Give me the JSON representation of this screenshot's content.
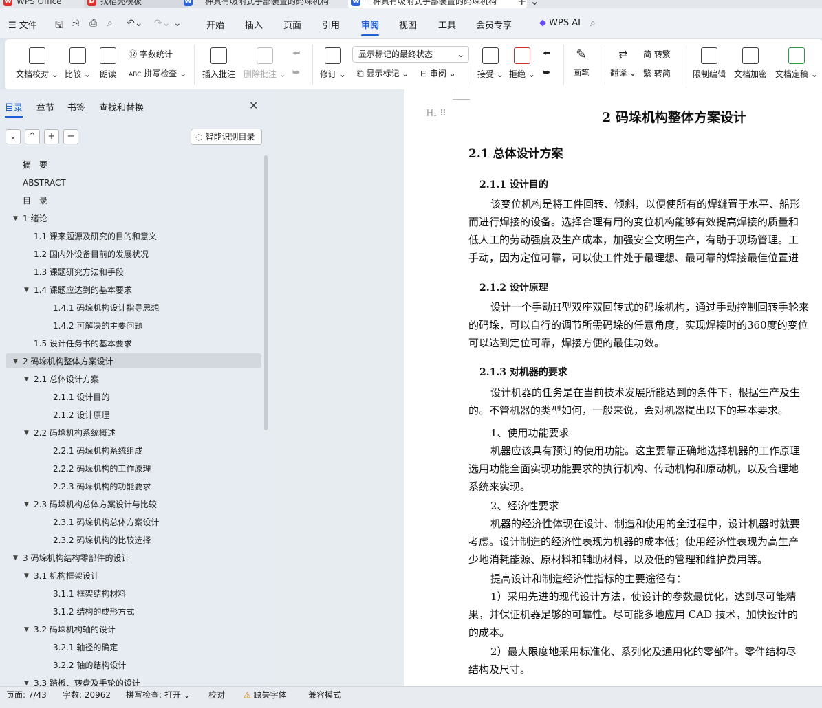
{
  "tabs": [
    {
      "label": "WPS Office",
      "icon": "wps-logo"
    },
    {
      "label": "找稻壳模板",
      "icon": "docer-logo"
    },
    {
      "label": "一种具有吸附式手部装置的码垛机构",
      "icon": "writer-icon"
    },
    {
      "label": "一种具有吸附式手部装置的码垛机构",
      "icon": "writer-icon"
    }
  ],
  "menubar": {
    "file": "文件",
    "items": [
      "开始",
      "插入",
      "页面",
      "引用",
      "审阅",
      "视图",
      "工具",
      "会员专享"
    ],
    "active": "审阅",
    "wps_ai": "WPS AI"
  },
  "ribbon": {
    "doc_check": "文档校对",
    "compare": "比较",
    "read_aloud": "朗读",
    "word_count": "字数统计",
    "spell_check": "拼写检查",
    "insert_comment": "插入批注",
    "delete_comment": "删除批注",
    "track": "修订",
    "markup_mode": "显示标记的最终状态",
    "show_markup": "显示标记",
    "review": "审阅",
    "accept": "接受",
    "reject": "拒绝",
    "pen": "画笔",
    "translate": "翻译",
    "to_trad": "转繁",
    "to_simp": "转简",
    "restrict_edit": "限制编辑",
    "encrypt": "文档加密",
    "finalize": "文档定稿"
  },
  "nav": {
    "tabs": [
      "目录",
      "章节",
      "书签",
      "查找和替换"
    ],
    "smart_toc": "智能识别目录",
    "toc": [
      {
        "text": "摘　要",
        "level": 0
      },
      {
        "text": "ABSTRACT",
        "level": 0
      },
      {
        "text": "目　录",
        "level": 0
      },
      {
        "text": "1  绪论",
        "level": 0,
        "expand": true
      },
      {
        "text": "1.1  课来题源及研究的目的和意义",
        "level": 1
      },
      {
        "text": "1.2  国内外设备目前的发展状况",
        "level": 1
      },
      {
        "text": "1.3  课题研究方法和手段",
        "level": 1
      },
      {
        "text": "1.4  课题应达到的基本要求",
        "level": 1,
        "expand": true
      },
      {
        "text": "1.4.1  码垛机构设计指导思想",
        "level": 2
      },
      {
        "text": "1.4.2  可解决的主要问题",
        "level": 2
      },
      {
        "text": "1.5  设计任务书的基本要求",
        "level": 1
      },
      {
        "text": "2  码垛机构整体方案设计",
        "level": 0,
        "expand": true
      },
      {
        "text": "2.1  总体设计方案",
        "level": 1,
        "expand": true
      },
      {
        "text": "2.1.1  设计目的",
        "level": 2
      },
      {
        "text": "2.1.2  设计原理",
        "level": 2
      },
      {
        "text": "2.2  码垛机构系统概述",
        "level": 1,
        "expand": true
      },
      {
        "text": "2.2.1  码垛机构系统组成",
        "level": 2
      },
      {
        "text": "2.2.2  码垛机构的工作原理",
        "level": 2
      },
      {
        "text": "2.2.3  码垛机构的功能要求",
        "level": 2
      },
      {
        "text": "2.3  码垛机构总体方案设计与比较",
        "level": 1,
        "expand": true
      },
      {
        "text": "2.3.1  码垛机构总体方案设计",
        "level": 2
      },
      {
        "text": "2.3.2  码垛机构的比较选择",
        "level": 2
      },
      {
        "text": "3  码垛机构结构零部件的设计",
        "level": 0,
        "expand": true
      },
      {
        "text": "3.1  机构框架设计",
        "level": 1,
        "expand": true
      },
      {
        "text": "3.1.1  框架结构材料",
        "level": 2
      },
      {
        "text": "3.1.2  结构的成形方式",
        "level": 2
      },
      {
        "text": "3.2  码垛机构轴的设计",
        "level": 1,
        "expand": true
      },
      {
        "text": "3.2.1  轴径的确定",
        "level": 2
      },
      {
        "text": "3.2.2  轴的结构设计",
        "level": 2
      },
      {
        "text": "3.3  踏板、转盘及手轮的设计",
        "level": 1,
        "expand": true
      }
    ]
  },
  "document": {
    "chapter_title": "2  码垛机构整体方案设计",
    "lines": [
      {
        "text": "2.1  总体设计方案",
        "style": "h2"
      },
      {
        "text": "2.1.1  设计目的",
        "style": "h3"
      },
      {
        "text": "该变位机构是将工件回转、倾斜，以便使所有的焊缝置于水平、船形",
        "style": "indent"
      },
      {
        "text": "而进行焊接的设备。选择合理有用的变位机构能够有效提高焊接的质量和",
        "style": "body"
      },
      {
        "text": "低人工的劳动强度及生产成本，加强安全文明生产，有助于现场管理。工",
        "style": "body"
      },
      {
        "text": "手动，因为定位可靠，可以使工件处于最理想、最可靠的焊接最佳位置进",
        "style": "body"
      },
      {
        "text": "2.1.2  设计原理",
        "style": "h3"
      },
      {
        "text": "设计一个手动H型双座双回转式的码垛机构，通过手动控制回转手轮来",
        "style": "indent"
      },
      {
        "text": "的码垛，可以自行的调节所需码垛的任意角度，实现焊接时的360度的变位",
        "style": "body"
      },
      {
        "text": "可以达到定位可靠，焊接方便的最佳功效。",
        "style": "body"
      },
      {
        "text": "2.1.3  对机器的要求",
        "style": "h3"
      },
      {
        "text": "设计机器的任务是在当前技术发展所能达到的条件下，根据生产及生",
        "style": "indent"
      },
      {
        "text": "的。不管机器的类型如何，一般来说，会对机器提出以下的基本要求。",
        "style": "body"
      },
      {
        "text": "1、使用功能要求",
        "style": "indent"
      },
      {
        "text": "机器应该具有预订的使用功能。这主要靠正确地选择机器的工作原理",
        "style": "indent"
      },
      {
        "text": "选用功能全面实现功能要求的执行机构、传动机构和原动机，以及合理地",
        "style": "body"
      },
      {
        "text": "系统来实现。",
        "style": "body"
      },
      {
        "text": "2、经济性要求",
        "style": "indent"
      },
      {
        "text": "机器的经济性体现在设计、制造和使用的全过程中，设计机器时就要",
        "style": "indent"
      },
      {
        "text": "考虑。设计制造的经济性表现为机器的成本低；使用经济性表现为高生产",
        "style": "body"
      },
      {
        "text": "少地消耗能源、原材料和辅助材料，以及低的管理和维护费用等。",
        "style": "body"
      },
      {
        "text": "提高设计和制造经济性指标的主要途径有：",
        "style": "indent"
      },
      {
        "text": "1）采用先进的现代设计方法，使设计的参数最优化，达到尽可能精",
        "style": "indent"
      },
      {
        "text": "果，并保证机器足够的可靠性。尽可能多地应用 CAD 技术，加快设计的",
        "style": "body"
      },
      {
        "text": "的成本。",
        "style": "body"
      },
      {
        "text": "2）最大限度地采用标准化、系列化及通用化的零部件。零件结构尽",
        "style": "indent"
      },
      {
        "text": "结构及尺寸。",
        "style": "body"
      }
    ]
  },
  "status": {
    "page": "页面: 7/43",
    "words": "字数: 20962",
    "spell": "拼写检查: 打开",
    "proof": "校对",
    "missing_font": "缺失字体",
    "compat": "兼容模式"
  }
}
